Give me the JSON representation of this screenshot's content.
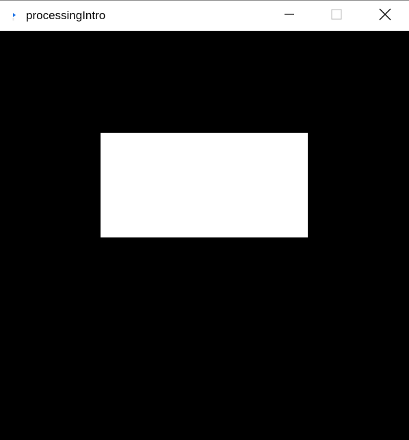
{
  "window": {
    "title": "processingIntro",
    "app_icon": "processing-app-icon",
    "controls": {
      "minimize_icon": "minimize-icon",
      "maximize_icon": "maximize-icon",
      "close_icon": "close-icon"
    }
  },
  "sketch": {
    "background_color": "#000000",
    "shape_fill_color": "#ffffff"
  },
  "colors": {
    "titlebar_bg": "#ffffff",
    "title_text": "#000000",
    "icon_accent": "#1e74e6"
  }
}
